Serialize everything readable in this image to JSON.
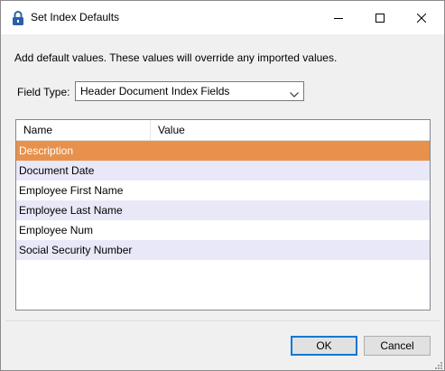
{
  "window": {
    "title": "Set Index Defaults",
    "icon": "lock-icon",
    "controls": [
      "minimize-icon",
      "maximize-icon",
      "close-icon"
    ]
  },
  "dialog": {
    "info_text": "Add default values. These values will override any imported values.",
    "field_type_label": "Field Type:",
    "field_type_value": "Header Document Index Fields"
  },
  "grid": {
    "columns": [
      "Name",
      "Value"
    ],
    "rows": [
      {
        "name": "Description",
        "value": "",
        "selected": true
      },
      {
        "name": "Document Date",
        "value": ""
      },
      {
        "name": "Employee First Name",
        "value": ""
      },
      {
        "name": "Employee Last Name",
        "value": ""
      },
      {
        "name": "Employee Num",
        "value": ""
      },
      {
        "name": "Social Security Number",
        "value": ""
      }
    ]
  },
  "buttons": {
    "ok": "OK",
    "cancel": "Cancel"
  },
  "colors": {
    "selected_row": "#e8914c",
    "alt_row": "#e8e8f8",
    "accent": "#0078d7"
  }
}
